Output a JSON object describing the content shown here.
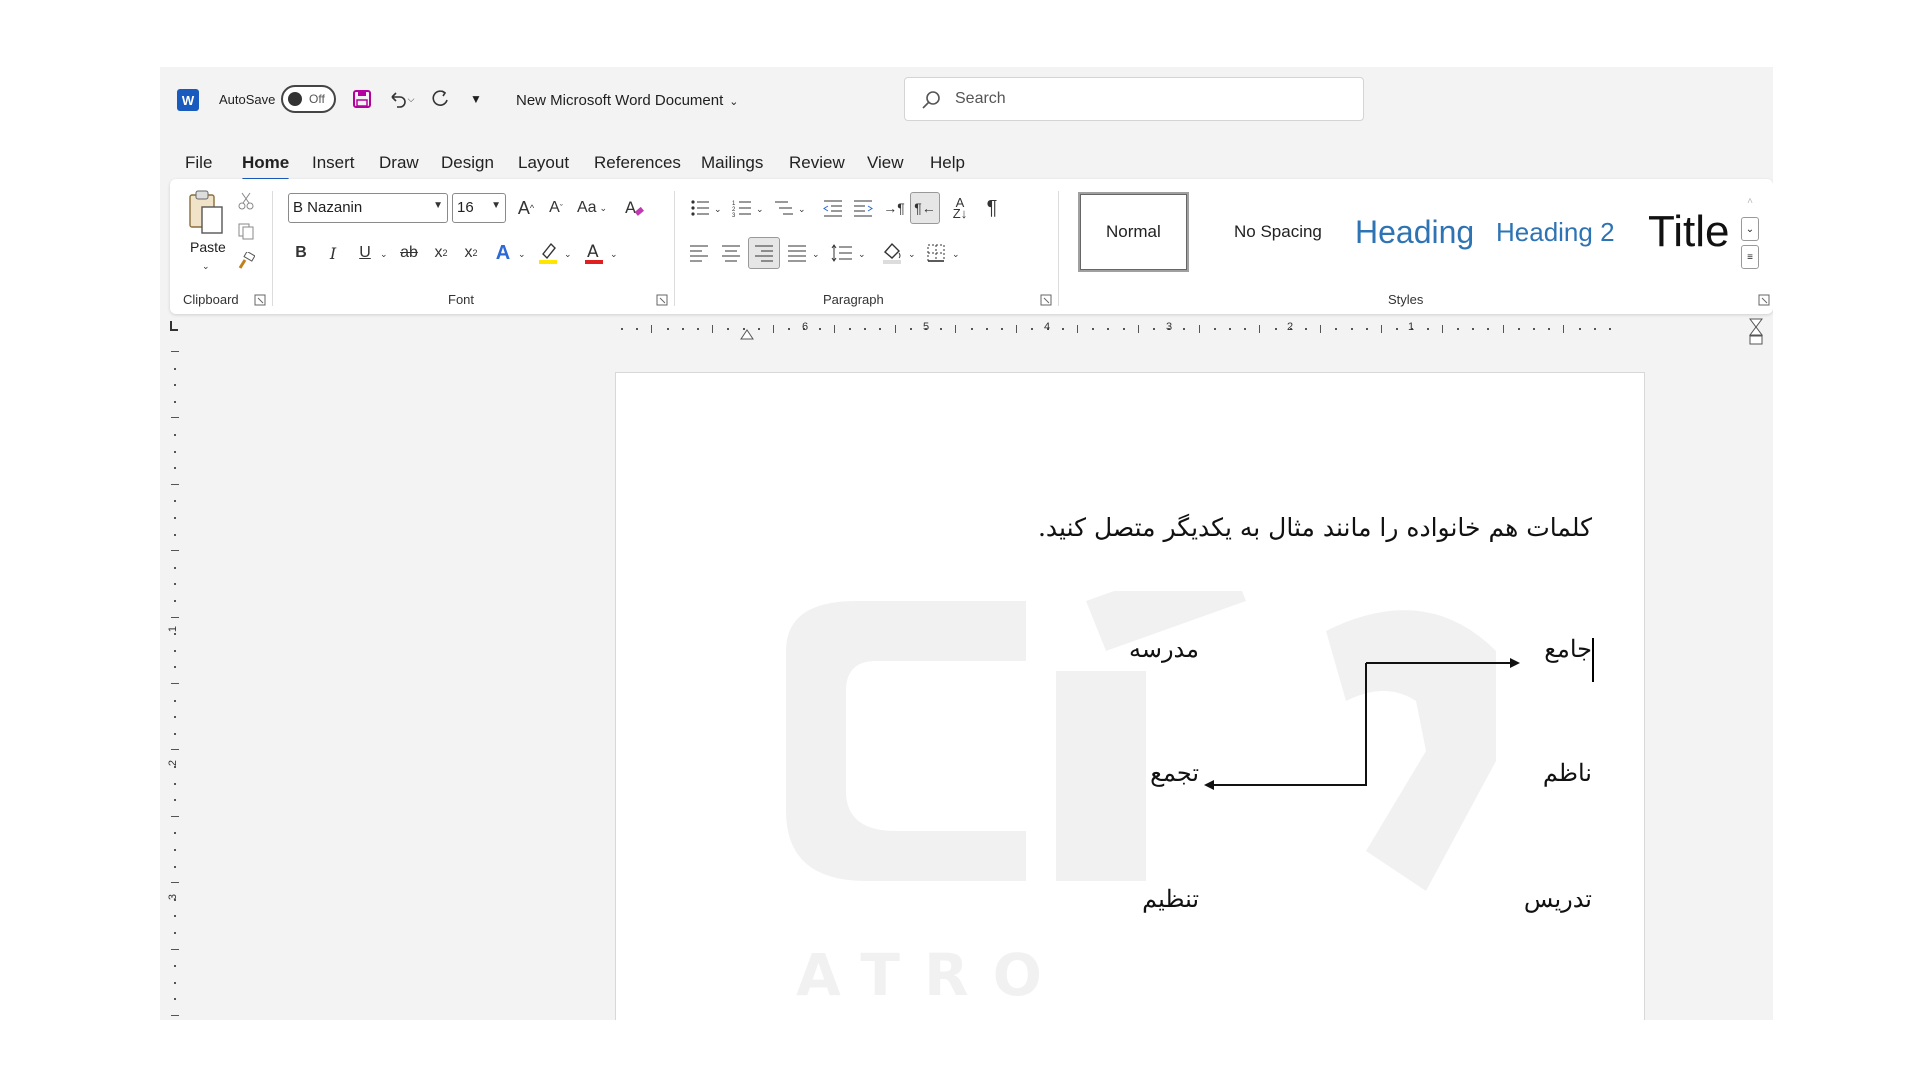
{
  "titlebar": {
    "autosave_label": "AutoSave",
    "autosave_state": "Off",
    "document_title": "New Microsoft Word Document",
    "search_placeholder": "Search"
  },
  "menu": [
    "File",
    "Home",
    "Insert",
    "Draw",
    "Design",
    "Layout",
    "References",
    "Mailings",
    "Review",
    "View",
    "Help"
  ],
  "menu_active": "Home",
  "ribbon": {
    "clipboard": {
      "paste_label": "Paste",
      "group_label": "Clipboard"
    },
    "font": {
      "font_name": "B Nazanin",
      "font_size": "16",
      "group_label": "Font"
    },
    "paragraph": {
      "group_label": "Paragraph"
    },
    "styles": {
      "group_label": "Styles",
      "items": [
        "Normal",
        "No Spacing",
        "Heading",
        "Heading 2",
        "Title"
      ]
    }
  },
  "ruler": {
    "horizontal_numbers": [
      "6",
      "5",
      "4",
      "3",
      "2",
      "1"
    ],
    "vertical_numbers": [
      "1",
      "2",
      "3"
    ]
  },
  "document": {
    "instruction": "کلمات هم خانواده را مانند مثال به یکدیگر متصل کنید.",
    "right_column": [
      "جامع",
      "ناظم",
      "تدریس"
    ],
    "left_column": [
      "مدرسه",
      "تجمع",
      "تنظیم"
    ],
    "watermark_text": "ATRO ACADEMY"
  },
  "colors": {
    "accent": "#185abd",
    "heading_blue": "#2e74b5",
    "save_icon": "#b4009e"
  }
}
